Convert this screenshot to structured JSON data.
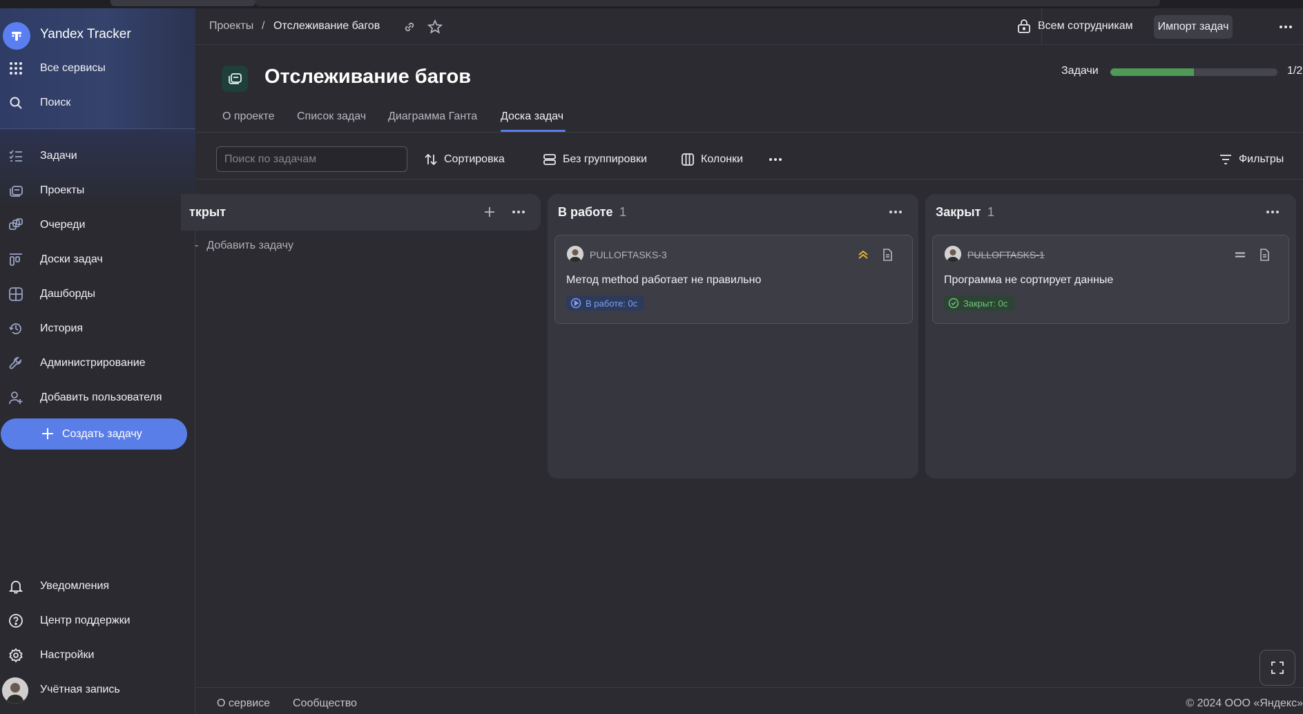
{
  "app": {
    "brand": "Yandex Tracker"
  },
  "sidebar": {
    "top_items": [
      {
        "label": "Все сервисы",
        "icon": "grid-icon"
      },
      {
        "label": "Поиск",
        "icon": "search-icon"
      }
    ],
    "items": [
      {
        "label": "Задачи",
        "icon": "tasks-icon"
      },
      {
        "label": "Проекты",
        "icon": "projects-icon"
      },
      {
        "label": "Очереди",
        "icon": "queues-icon"
      },
      {
        "label": "Доски задач",
        "icon": "boards-icon"
      },
      {
        "label": "Дашборды",
        "icon": "dashboards-icon"
      },
      {
        "label": "История",
        "icon": "history-icon"
      },
      {
        "label": "Администрирование",
        "icon": "wrench-icon"
      },
      {
        "label": "Добавить пользователя",
        "icon": "add-user-icon"
      }
    ],
    "create_label": "Создать задачу",
    "bottom_items": [
      {
        "label": "Уведомления",
        "icon": "bell-icon"
      },
      {
        "label": "Центр поддержки",
        "icon": "help-icon"
      },
      {
        "label": "Настройки",
        "icon": "gear-icon"
      },
      {
        "label": "Учётная запись",
        "icon": "avatar"
      }
    ]
  },
  "header": {
    "breadcrumb_root": "Проекты",
    "breadcrumb_sep": "/",
    "breadcrumb_current": "Отслеживание багов",
    "access_label": "Всем сотрудникам",
    "import_label": "Импорт задач"
  },
  "project": {
    "title": "Отслеживание багов",
    "tasks_label": "Задачи",
    "progress_fraction": 0.5,
    "progress_count": "1/2",
    "tabs": [
      {
        "label": "О проекте",
        "active": false
      },
      {
        "label": "Список задач",
        "active": false
      },
      {
        "label": "Диаграмма Ганта",
        "active": false
      },
      {
        "label": "Доска задач",
        "active": true
      }
    ]
  },
  "toolbar": {
    "search_placeholder": "Поиск по задачам",
    "sort_label": "Сортировка",
    "group_label": "Без группировки",
    "columns_label": "Колонки",
    "filters_label": "Фильтры"
  },
  "board": {
    "columns": [
      {
        "name": "ткрыт",
        "count": "",
        "add_task_label": "Добавить задачу",
        "cards": []
      },
      {
        "name": "В работе",
        "count": "1",
        "cards": [
          {
            "key": "PULLOFTASKS-3",
            "summary": "Метод method работает не правильно",
            "status": "В работе: 0с",
            "priority_icon": "priority-high-icon",
            "closed": false
          }
        ]
      },
      {
        "name": "Закрыт",
        "count": "1",
        "cards": [
          {
            "key": "PULLOFTASKS-1",
            "summary": "Программа не сортирует данные",
            "status": "Закрыт: 0с",
            "priority_icon": "priority-normal-icon",
            "closed": true
          }
        ]
      }
    ]
  },
  "footer": {
    "about": "О сервисе",
    "community": "Сообщество",
    "copyright": "© 2024 ООО «Яндекс»"
  },
  "colors": {
    "accent": "#5a7ee8",
    "progress": "#4f9a56",
    "background": "#2b2b31",
    "column": "#36363e"
  }
}
